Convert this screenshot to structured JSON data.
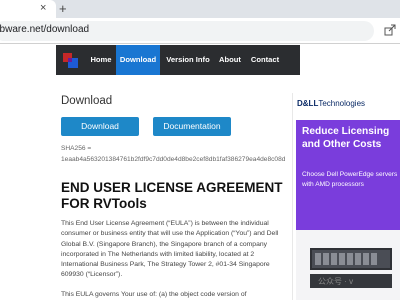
{
  "browser": {
    "close_glyph": "×",
    "new_tab_glyph": "+",
    "url": "obware.net/download"
  },
  "nav": {
    "items": [
      {
        "label": "Home"
      },
      {
        "label": "Download",
        "active": true
      },
      {
        "label": "Version Info"
      },
      {
        "label": "About"
      },
      {
        "label": "Contact"
      }
    ]
  },
  "page": {
    "title": "Download",
    "download_button": "Download",
    "documentation_button": "Documentation",
    "sha_label": "SHA256 =",
    "sha_value": "1eaab4a563201384761b2fdf9c7dd0de4d8be2cef8db1faf386279ea4de8c08d",
    "eula_heading": "END USER LICENSE AGREEMENT FOR RVTools",
    "eula_p1": "This End User License Agreement (“EULA”) is between the individual consumer or business entity that will use the Application (“You”) and Dell Global B.V. (Singapore Branch), the Singapore branch of a company incorporated in The Netherlands with limited liability, located at 2 International Business Park, The Strategy Tower 2, #01-34 Singapore 609930 (“Licensor”).",
    "eula_p2": "This EULA governs Your use of: (a) the object code version of"
  },
  "ad": {
    "brand": "D&LL",
    "brand_suffix": "Technologies",
    "headline": "Reduce Licensing and Other Costs",
    "subtext": "Choose Dell PowerEdge servers with AMD processors",
    "accent": "#7a3ddc"
  },
  "watermark": "公众号 · v",
  "colors": {
    "nav_bg": "#2b2d30",
    "nav_active": "#1976d2",
    "button": "#1e88c8"
  }
}
